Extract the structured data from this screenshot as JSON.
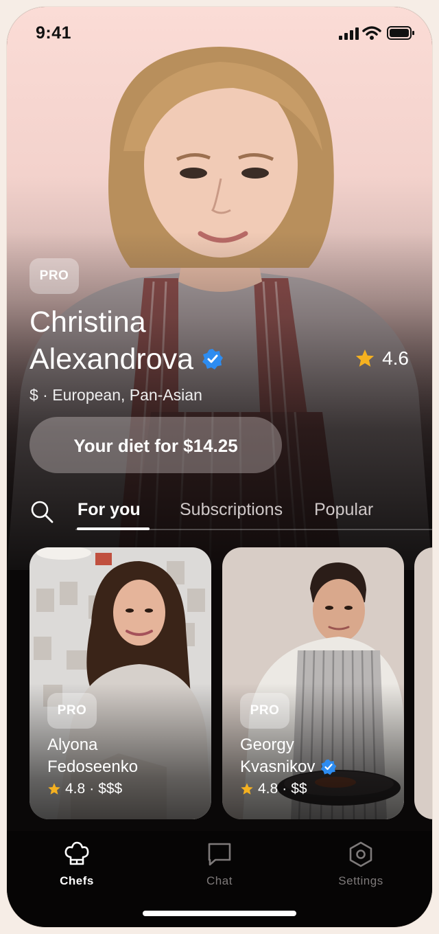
{
  "status_bar": {
    "time": "9:41"
  },
  "hero": {
    "badge": "PRO",
    "name_line1": "Christina",
    "name_line2": "Alexandrova",
    "rating": "4.6",
    "meta": "$ · European, Pan-Asian",
    "cta": "Your diet for $14.25"
  },
  "tabs": [
    {
      "label": "For you",
      "active": true
    },
    {
      "label": "Subscriptions",
      "active": false
    },
    {
      "label": "Popular",
      "active": false
    }
  ],
  "cards": [
    {
      "badge": "PRO",
      "name_line1": "Alyona",
      "name_line2": "Fedoseenko",
      "rating": "4.8",
      "price": "$$$",
      "verified": false
    },
    {
      "badge": "PRO",
      "name_line1": "Georgy",
      "name_line2": "Kvasnikov",
      "rating": "4.8",
      "price": "$$",
      "verified": true
    }
  ],
  "nav": [
    {
      "label": "Chefs",
      "icon": "chef-hat-icon",
      "active": true
    },
    {
      "label": "Chat",
      "icon": "chat-icon",
      "active": false
    },
    {
      "label": "Settings",
      "icon": "settings-hexagon-icon",
      "active": false
    }
  ],
  "colors": {
    "star": "#f5b120",
    "verified": "#2d8cf0",
    "hero_bg": "#fbdcd6",
    "dark_bg": "#0a0808"
  }
}
